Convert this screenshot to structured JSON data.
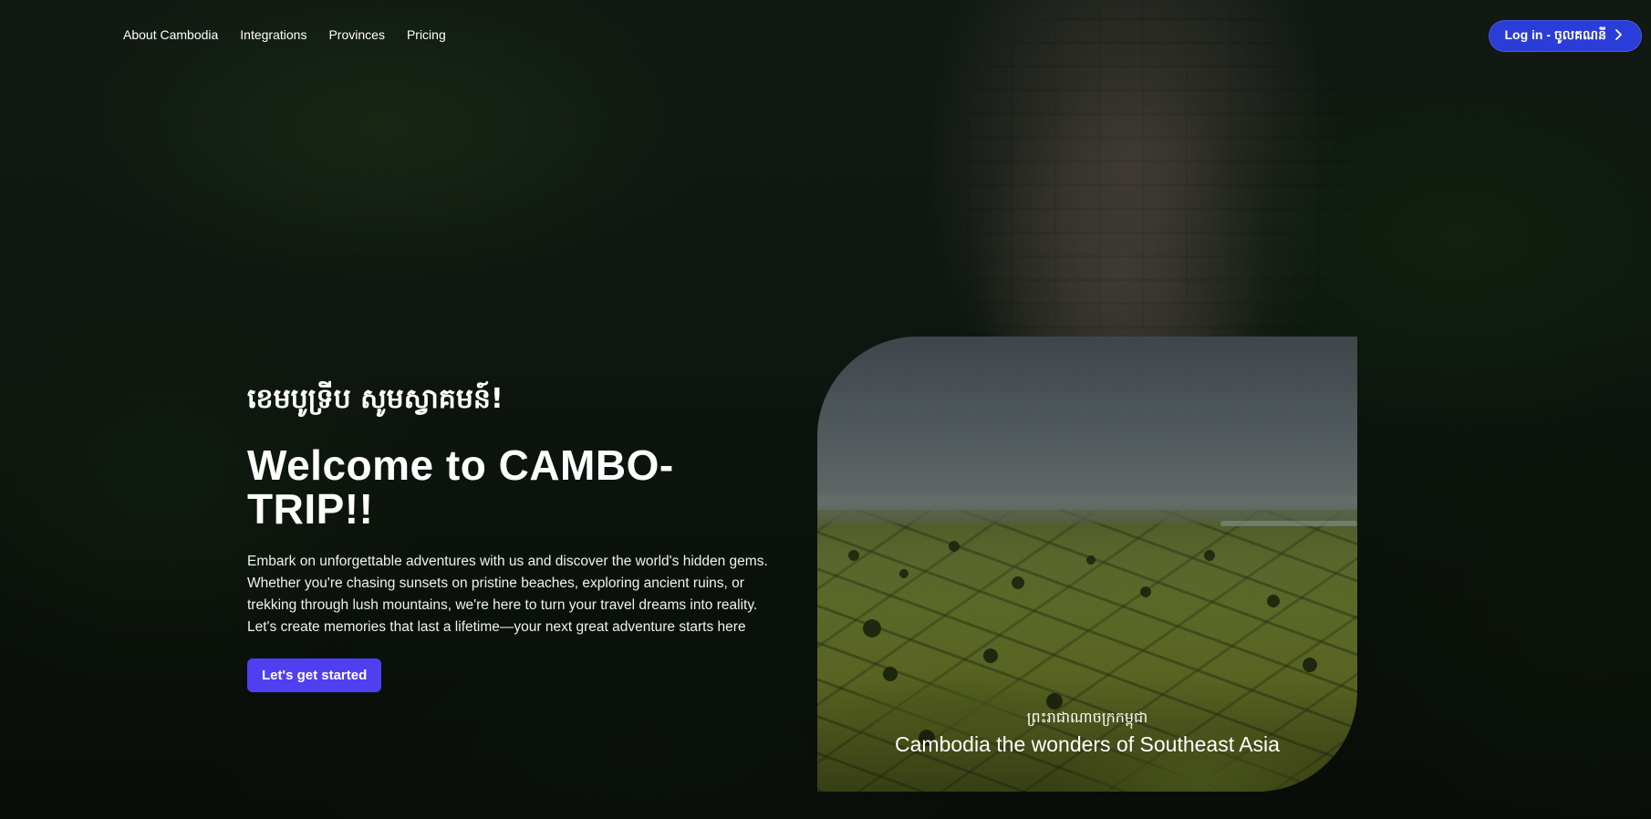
{
  "nav": {
    "items": [
      {
        "label": "About Cambodia"
      },
      {
        "label": "Integrations"
      },
      {
        "label": "Provinces"
      },
      {
        "label": "Pricing"
      }
    ],
    "login_label": "Log in - ចូលគណនី"
  },
  "hero": {
    "khmer_greeting": "ខេមបូទ្រីប សូមស្វាគមន៍!",
    "title": "Welcome to CAMBO-TRIP!!",
    "description": "Embark on unforgettable adventures with us and discover the world's hidden gems. Whether you're chasing sunsets on pristine beaches, exploring ancient ruins, or trekking through lush mountains, we're here to turn your travel dreams into reality. Let's create memories that last a lifetime—your next great adventure starts here",
    "cta_label": "Let's get started"
  },
  "card": {
    "caption_khmer": "ព្រះរាជាណាចក្រកម្ពុជា",
    "caption_english": "Cambodia the wonders of Southeast Asia"
  },
  "colors": {
    "login_button": "#2b3dd8",
    "cta_button": "#4f3ff0"
  },
  "icons": {
    "login_chevron": "chevron-right-icon"
  }
}
